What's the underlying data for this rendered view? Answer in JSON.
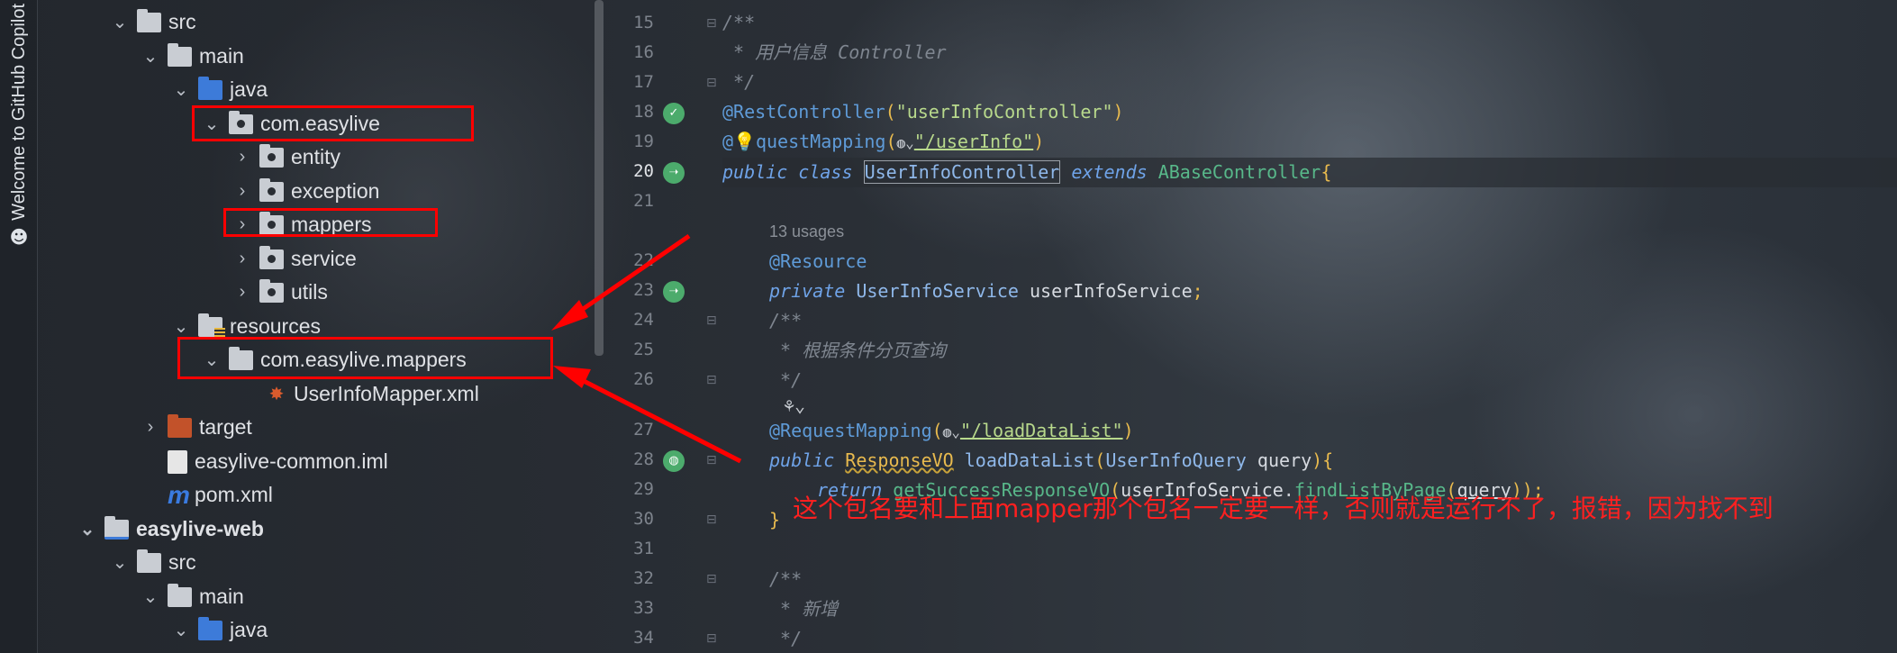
{
  "sidebar_tab": {
    "label": "Welcome to GitHub Copilot",
    "icon": "copilot-icon"
  },
  "tree": {
    "items": [
      {
        "label": "src",
        "chevron": "⌄",
        "icon": "folder-icon"
      },
      {
        "label": "main",
        "chevron": "⌄",
        "icon": "folder-icon"
      },
      {
        "label": "java",
        "chevron": "⌄",
        "icon": "source-folder-icon"
      },
      {
        "label": "com.easylive",
        "chevron": "⌄",
        "icon": "package-icon"
      },
      {
        "label": "entity",
        "chevron": "›",
        "icon": "package-icon"
      },
      {
        "label": "exception",
        "chevron": "›",
        "icon": "package-icon"
      },
      {
        "label": "mappers",
        "chevron": "›",
        "icon": "package-icon"
      },
      {
        "label": "service",
        "chevron": "›",
        "icon": "package-icon"
      },
      {
        "label": "utils",
        "chevron": "›",
        "icon": "package-icon"
      },
      {
        "label": "resources",
        "chevron": "⌄",
        "icon": "resources-folder-icon"
      },
      {
        "label": "com.easylive.mappers",
        "chevron": "⌄",
        "icon": "folder-icon"
      },
      {
        "label": "UserInfoMapper.xml",
        "chevron": "",
        "icon": "xml-file-icon"
      },
      {
        "label": "target",
        "chevron": "›",
        "icon": "excluded-folder-icon"
      },
      {
        "label": "easylive-common.iml",
        "chevron": "",
        "icon": "iml-file-icon"
      },
      {
        "label": "pom.xml",
        "chevron": "",
        "icon": "maven-icon"
      },
      {
        "label": "easylive-web",
        "chevron": "⌄",
        "icon": "module-icon"
      },
      {
        "label": "src",
        "chevron": "⌄",
        "icon": "folder-icon"
      },
      {
        "label": "main",
        "chevron": "⌄",
        "icon": "folder-icon"
      },
      {
        "label": "java",
        "chevron": "⌄",
        "icon": "source-folder-icon"
      }
    ]
  },
  "gutter": {
    "line_numbers": [
      "15",
      "16",
      "17",
      "18",
      "19",
      "20",
      "21",
      "22",
      "23",
      "24",
      "25",
      "26",
      "27",
      "28",
      "29",
      "30",
      "31",
      "32",
      "33",
      "34"
    ],
    "active_line": "20"
  },
  "code": {
    "l15": "/**",
    "l16": " * 用户信息 Controller",
    "l17": " */",
    "l18_ann": "@RestController",
    "l18_open": "(",
    "l18_str": "\"userInfoController\"",
    "l18_close": ")",
    "l19_at": "@",
    "l19_rest": "questMapping",
    "l19_open": "(",
    "l19_str": "\"/userInfo\"",
    "l19_close": ")",
    "l20_kw1": "public",
    "l20_kw2": "class",
    "l20_cls": "UserInfoController",
    "l20_kw3": "extends",
    "l20_base": "ABaseController",
    "l20_brace": "{",
    "usages": "13 usages",
    "l22": "@Resource",
    "l23_kw": "private",
    "l23_type": "UserInfoService",
    "l23_var": "userInfoService",
    "l23_end": ";",
    "l24": "/**",
    "l25": " * 根据条件分页查询",
    "l26": " */",
    "l27_ann": "@RequestMapping",
    "l27_open": "(",
    "l27_str": "\"/loadDataList\"",
    "l27_close": ")",
    "l28_kw": "public",
    "l28_type": "ResponseVO",
    "l28_method": "loadDataList",
    "l28_open": "(",
    "l28_ptype": "UserInfoQuery",
    "l28_pname": "query",
    "l28_close": "){",
    "l29_kw": "return",
    "l29_call": "getSuccessResponseVO",
    "l29_open": "(",
    "l29_obj": "userInfoService",
    "l29_dot": ".",
    "l29_method": "findListByPage",
    "l29_arg_open": "(",
    "l29_arg": "query",
    "l29_end": "));",
    "l30": "}",
    "l32": "/**",
    "l33": " * 新增",
    "l34": " */"
  },
  "annotation": "这个包名要和上面mapper那个包名一定要一样，否则就是运行不了，报错，因为找不到",
  "colors": {
    "highlight_box": "#ff0000",
    "annotation_text": "#ff2020",
    "gutter_icon": "#4cab6c"
  }
}
